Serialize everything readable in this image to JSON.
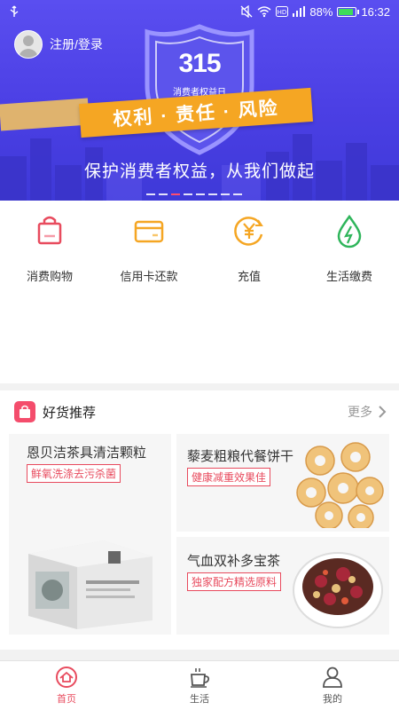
{
  "status_bar": {
    "battery": "88%",
    "time": "16:32",
    "battery_level": 0.88
  },
  "banner": {
    "login_label": "注册/登录",
    "logo_number": "315",
    "logo_subtitle": "消费者权益日",
    "ribbon_text": "权利 · 责任 · 风险",
    "slogan": "保护消费者权益，从我们做起",
    "active_slide": 2,
    "slide_count": 8
  },
  "quick_actions": [
    {
      "label": "消费购物",
      "icon": "shopping-bag-icon",
      "color": "#e84b5e"
    },
    {
      "label": "信用卡还款",
      "icon": "credit-card-icon",
      "color": "#f5a623"
    },
    {
      "label": "充值",
      "icon": "yen-recharge-icon",
      "color": "#f5a623"
    },
    {
      "label": "生活缴费",
      "icon": "water-drop-icon",
      "color": "#2fb55b"
    }
  ],
  "recommend": {
    "title": "好货推荐",
    "more_label": "更多",
    "products": [
      {
        "title": "恩贝洁茶具清洁颗粒",
        "tag": "鲜氧洗涤去污杀菌"
      },
      {
        "title": "藜麦粗粮代餐饼干",
        "tag": "健康减重效果佳"
      },
      {
        "title": "气血双补多宝茶",
        "tag": "独家配方精选原料"
      }
    ]
  },
  "tabs": [
    {
      "label": "首页",
      "icon": "home-icon",
      "active": true
    },
    {
      "label": "生活",
      "icon": "coffee-cup-icon",
      "active": false
    },
    {
      "label": "我的",
      "icon": "user-icon",
      "active": false
    }
  ],
  "colors": {
    "banner": "#4b3fe4",
    "accent": "#e84b5e",
    "ribbon": "#f5a623"
  }
}
